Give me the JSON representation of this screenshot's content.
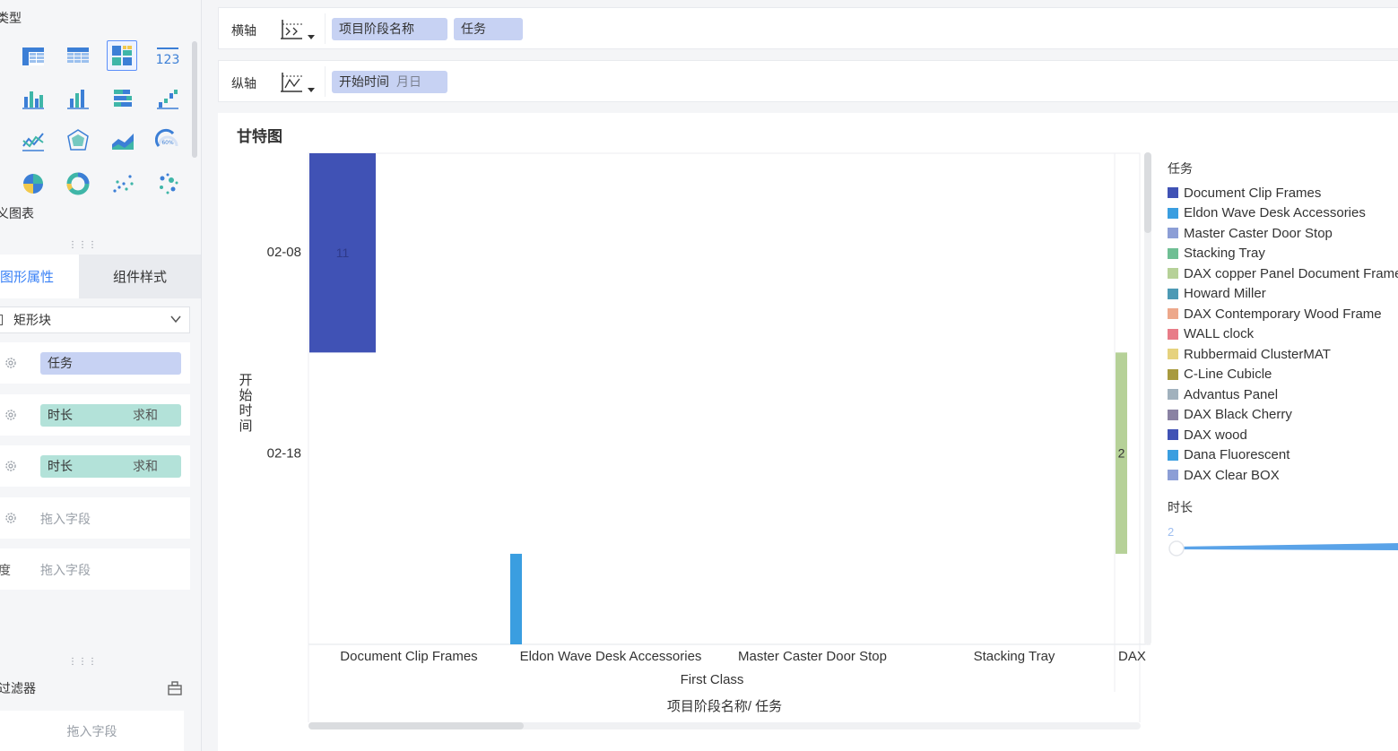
{
  "left_panel": {
    "chart_type_title": "类型",
    "custom_chart_label": "义图表",
    "tabs": {
      "graph_props": "图形属性",
      "component_style": "组件样式"
    },
    "mark_type": "矩形块",
    "fields": [
      {
        "prefix": "",
        "pill": "任务",
        "agg": "",
        "kind": "blue"
      },
      {
        "prefix": "",
        "pill": "时长",
        "agg": "求和",
        "kind": "teal"
      },
      {
        "prefix": "",
        "pill": "时长",
        "agg": "求和",
        "kind": "teal"
      },
      {
        "prefix": "",
        "hint": "拖入字段"
      },
      {
        "prefix": "度",
        "hint": "拖入字段"
      }
    ],
    "filter_title": "过滤器",
    "filter_hint": "拖入字段"
  },
  "shelves": {
    "x": {
      "label": "横轴",
      "pills": [
        "项目阶段名称",
        "任务"
      ]
    },
    "y": {
      "label": "纵轴",
      "pill": "开始时间",
      "pill_sub": "月日"
    }
  },
  "chart": {
    "title": "甘特图",
    "legend_title": "任务",
    "size_legend_title": "时长",
    "size_legend_min": "2"
  },
  "legend_items": [
    {
      "name": "Document Clip Frames",
      "color": "#4052b5"
    },
    {
      "name": "Eldon Wave Desk Accessories",
      "color": "#3a9ee0"
    },
    {
      "name": "Master Caster Door Stop",
      "color": "#8c9ed6"
    },
    {
      "name": "Stacking Tray",
      "color": "#6fbf94"
    },
    {
      "name": "DAX copper Panel Document Frame",
      "color": "#b6d198"
    },
    {
      "name": "Howard Miller",
      "color": "#4d9ab5"
    },
    {
      "name": "DAX Contemporary Wood Frame",
      "color": "#eda88b"
    },
    {
      "name": "WALL clock",
      "color": "#e87c88"
    },
    {
      "name": "Rubbermaid ClusterMAT",
      "color": "#e6d27e"
    },
    {
      "name": "C-Line Cubicle",
      "color": "#a89a3e"
    },
    {
      "name": "Advantus Panel",
      "color": "#a1b1bd"
    },
    {
      "name": "DAX Black Cherry",
      "color": "#8a82a3"
    },
    {
      "name": "DAX wood",
      "color": "#4052b5"
    },
    {
      "name": "Dana Fluorescent",
      "color": "#3a9ee0"
    },
    {
      "name": "DAX Clear BOX",
      "color": "#8c9ed6"
    }
  ],
  "chart_data": {
    "type": "bar",
    "title": "甘特图",
    "xlabel": "项目阶段名称/ 任务",
    "ylabel": "开始时间",
    "x_group": "First Class",
    "categories": [
      "Document Clip Frames",
      "Eldon Wave Desk Accessories",
      "Master Caster Door Stop",
      "Stacking Tray",
      "DAX"
    ],
    "y_ticks": [
      "02-08",
      "02-18"
    ],
    "y_tick_days": [
      8,
      18
    ],
    "y_range_days": [
      3.1,
      27.5
    ],
    "bars": [
      {
        "category": "Document Clip Frames",
        "start_day": 3.1,
        "end_day": 13.0,
        "duration": 11,
        "label": "11",
        "color": "#4052b5"
      },
      {
        "category": "Eldon Wave Desk Accessories",
        "start_day": 23.0,
        "end_day": 27.5,
        "color": "#3a9ee0"
      },
      {
        "category": "DAX",
        "start_day": 13.0,
        "end_day": 23.0,
        "duration": 2,
        "label": "2",
        "color": "#b6d198"
      }
    ]
  }
}
